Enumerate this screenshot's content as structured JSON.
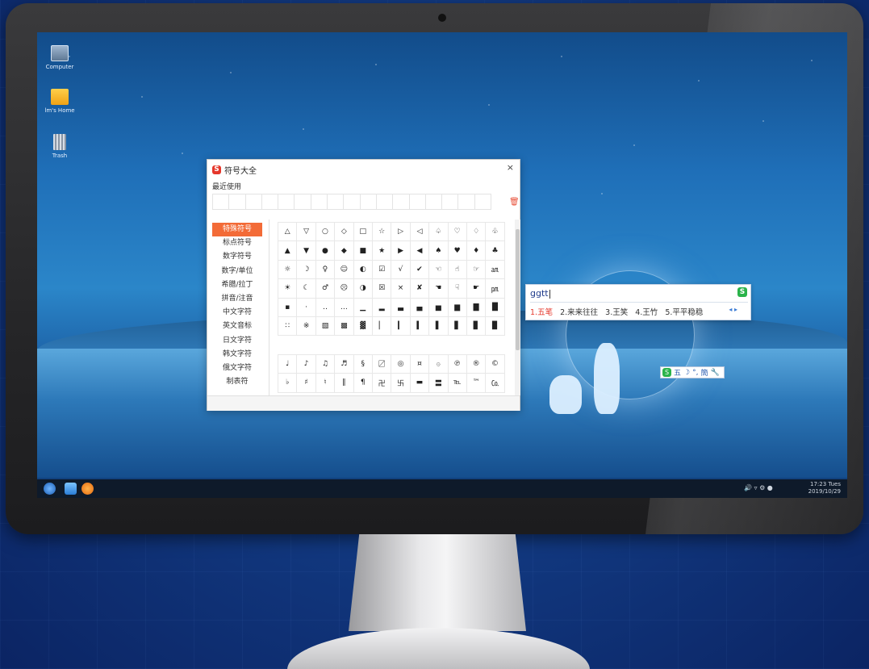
{
  "desktop": {
    "icons": [
      {
        "label": "Computer",
        "icon": "computer-icon"
      },
      {
        "label": "lm's Home",
        "icon": "folder-icon"
      },
      {
        "label": "Trash",
        "icon": "trash-icon"
      }
    ]
  },
  "symbol_window": {
    "title": "符号大全",
    "close": "×",
    "recent_label": "最近使用",
    "recent_slots": 17,
    "clear_icon": "🗑",
    "categories": [
      "特殊符号",
      "标点符号",
      "数字符号",
      "数字/单位",
      "希腊/拉丁",
      "拼音/注音",
      "中文字符",
      "英文音标",
      "日文字符",
      "韩文字符",
      "俄文字符",
      "制表符"
    ],
    "active_category": "特殊符号",
    "symbols": [
      [
        "△",
        "▽",
        "○",
        "◇",
        "□",
        "☆",
        "▷",
        "◁",
        "♤",
        "♡",
        "♢",
        "♧"
      ],
      [
        "▲",
        "▼",
        "●",
        "◆",
        "■",
        "★",
        "▶",
        "◀",
        "♠",
        "♥",
        "♦",
        "♣"
      ],
      [
        "☼",
        "☽",
        "♀",
        "☺",
        "◐",
        "☑",
        "√",
        "✔",
        "☜",
        "☝",
        "☞",
        "㏂"
      ],
      [
        "☀",
        "☾",
        "♂",
        "☹",
        "◑",
        "☒",
        "×",
        "✘",
        "☚",
        "☟",
        "☛",
        "㏘"
      ],
      [
        "▪",
        "·",
        "‥",
        "…",
        "▁",
        "▂",
        "▃",
        "▄",
        "▅",
        "▆",
        "▇",
        "█"
      ],
      [
        "∷",
        "※",
        "▧",
        "▩",
        "▓",
        "▏",
        "▎",
        "▍",
        "▌",
        "▋",
        "▊",
        "▉"
      ],
      [
        "",
        "",
        "",
        "",
        "",
        "",
        "",
        "",
        "",
        "",
        "",
        ""
      ],
      [
        "♩",
        "♪",
        "♫",
        "♬",
        "§",
        "〼",
        "◎",
        "¤",
        "۞",
        "℗",
        "®",
        "©"
      ],
      [
        "♭",
        "♯",
        "♮",
        "‖",
        "¶",
        "卍",
        "卐",
        "▬",
        "〓",
        "℡",
        "™",
        "㏇"
      ]
    ]
  },
  "ime": {
    "input": "ggtt",
    "logo": "S",
    "candidates": [
      "1.五笔",
      "2.来来往往",
      "3.王笑",
      "4.王竹",
      "5.平平稳稳"
    ],
    "arrows": "◂ ▸"
  },
  "ime_statusbar": {
    "logo": "S",
    "mode": "五",
    "moon": "☽",
    "punct": "°,",
    "script": "簡",
    "tool": "🔧"
  },
  "taskbar": {
    "tray": "🔊 ▿ ⚙ ●",
    "time": "17:23 Tues",
    "date": "2019/10/29"
  },
  "colors": {
    "accent": "#f36b37",
    "sogou_red": "#e5372b",
    "ime_green": "#2ab34a"
  }
}
